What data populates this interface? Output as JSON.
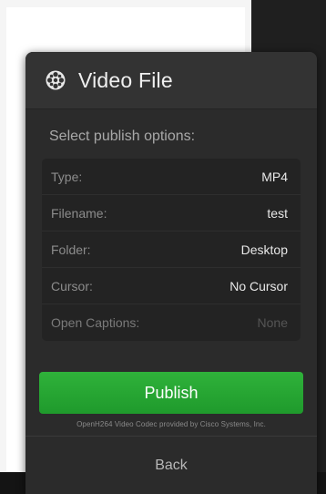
{
  "dialog": {
    "title": "Video File",
    "icon": "film-reel-icon",
    "subtitle": "Select publish options:",
    "options": [
      {
        "label": "Type:",
        "value": "MP4",
        "enabled": true
      },
      {
        "label": "Filename:",
        "value": "test",
        "enabled": true
      },
      {
        "label": "Folder:",
        "value": "Desktop",
        "enabled": true
      },
      {
        "label": "Cursor:",
        "value": "No Cursor",
        "enabled": true
      },
      {
        "label": "Open Captions:",
        "value": "None",
        "enabled": false
      }
    ],
    "publish_label": "Publish",
    "codec_note": "OpenH264 Video Codec provided by Cisco Systems, Inc.",
    "back_label": "Back"
  },
  "colors": {
    "panel": "#2b2b2b",
    "header": "#333333",
    "publish": "#2aa836"
  }
}
